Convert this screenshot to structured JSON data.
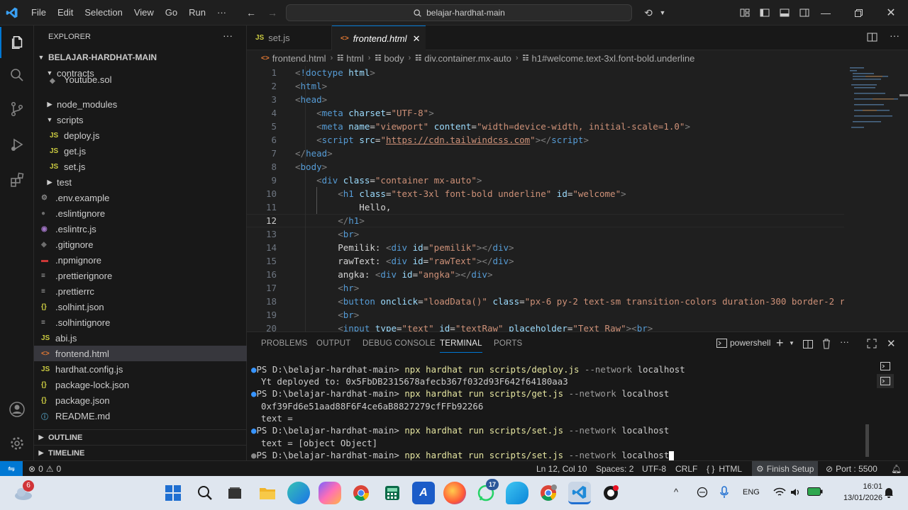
{
  "titlebar": {
    "menus": [
      "File",
      "Edit",
      "Selection",
      "View",
      "Go",
      "Run",
      "···"
    ],
    "search": "belajar-hardhat-main"
  },
  "sidebar": {
    "header": "EXPLORER",
    "root": "BELAJAR-HARDHAT-MAIN",
    "items": [
      {
        "label": "contracts",
        "kind": "folder-open",
        "indent": 1
      },
      {
        "label": "Youtube.sol",
        "kind": "sol",
        "indent": 2
      },
      {
        "label": "node_modules",
        "kind": "folder",
        "indent": 1
      },
      {
        "label": "scripts",
        "kind": "folder-open",
        "indent": 1
      },
      {
        "label": "deploy.js",
        "kind": "js",
        "indent": 2
      },
      {
        "label": "get.js",
        "kind": "js",
        "indent": 2
      },
      {
        "label": "set.js",
        "kind": "js",
        "indent": 2
      },
      {
        "label": "test",
        "kind": "folder",
        "indent": 1
      },
      {
        "label": ".env.example",
        "kind": "gear",
        "indent": 1
      },
      {
        "label": ".eslintignore",
        "kind": "dot",
        "indent": 1
      },
      {
        "label": ".eslintrc.js",
        "kind": "eslint",
        "indent": 1
      },
      {
        "label": ".gitignore",
        "kind": "git",
        "indent": 1
      },
      {
        "label": ".npmignore",
        "kind": "npm",
        "indent": 1
      },
      {
        "label": ".prettierignore",
        "kind": "lines",
        "indent": 1
      },
      {
        "label": ".prettierrc",
        "kind": "lines",
        "indent": 1
      },
      {
        "label": ".solhint.json",
        "kind": "json",
        "indent": 1
      },
      {
        "label": ".solhintignore",
        "kind": "lines",
        "indent": 1
      },
      {
        "label": "abi.js",
        "kind": "js",
        "indent": 1
      },
      {
        "label": "frontend.html",
        "kind": "html",
        "indent": 1
      },
      {
        "label": "hardhat.config.js",
        "kind": "js",
        "indent": 1
      },
      {
        "label": "package-lock.json",
        "kind": "json",
        "indent": 1
      },
      {
        "label": "package.json",
        "kind": "json",
        "indent": 1
      },
      {
        "label": "README.md",
        "kind": "info",
        "indent": 1
      }
    ],
    "outline": "OUTLINE",
    "timeline": "TIMELINE"
  },
  "tabs": [
    {
      "label": "set.js",
      "icon": "JS"
    },
    {
      "label": "frontend.html",
      "icon": "<>"
    }
  ],
  "breadcrumb": [
    "frontend.html",
    "html",
    "body",
    "div.container.mx-auto",
    "h1#welcome.text-3xl.font-bold.underline"
  ],
  "code": {
    "line_numbers": [
      "1",
      "2",
      "3",
      "4",
      "5",
      "6",
      "7",
      "8",
      "9",
      "10",
      "11",
      "12",
      "13",
      "14",
      "15",
      "16",
      "17",
      "18",
      "19",
      "20"
    ],
    "current_line": 12
  },
  "panel": {
    "tabs": [
      "PROBLEMS",
      "OUTPUT",
      "DEBUG CONSOLE",
      "TERMINAL",
      "PORTS"
    ],
    "active": "TERMINAL",
    "shell": "powershell",
    "terminal": [
      {
        "prompt": "PS D:\\belajar-hardhat-main> ",
        "cmd": "npx hardhat run scripts/deploy.js ",
        "flag": "--network",
        "arg": " localhost",
        "dot": "blue"
      },
      {
        "text": "Yt deployed to: 0x5FbDB2315678afecb367f032d93F642f64180aa3"
      },
      {
        "prompt": "PS D:\\belajar-hardhat-main> ",
        "cmd": "npx hardhat run scripts/get.js ",
        "flag": "--network",
        "arg": " localhost",
        "dot": "blue"
      },
      {
        "text": "0xf39Fd6e51aad88F6F4ce6aB8827279cfFFb92266"
      },
      {
        "text": "text ="
      },
      {
        "prompt": "PS D:\\belajar-hardhat-main> ",
        "cmd": "npx hardhat run scripts/set.js ",
        "flag": "--network",
        "arg": " localhost",
        "dot": "blue"
      },
      {
        "text": "text = [object Object]"
      },
      {
        "prompt": "PS D:\\belajar-hardhat-main> ",
        "cmd": "npx hardhat run scripts/set.js ",
        "flag": "--network",
        "arg": " localhost",
        "dot": "gray"
      }
    ]
  },
  "statusbar": {
    "errors": "0",
    "warnings": "0",
    "position": "Ln 12, Col 10",
    "spaces": "Spaces: 2",
    "encoding": "UTF-8",
    "eol": "CRLF",
    "language": "HTML",
    "finish": "Finish Setup",
    "port": "Port : 5500"
  },
  "taskbar": {
    "weather_badge": "6",
    "whatsapp_badge": "17",
    "language": "ENG",
    "time": "16:01",
    "date": "13/01/2026"
  },
  "colors": {
    "accent": "#0078d4",
    "bg": "#1f1f1f",
    "sidebar": "#181818",
    "taskbar": "#dfe6ef"
  }
}
